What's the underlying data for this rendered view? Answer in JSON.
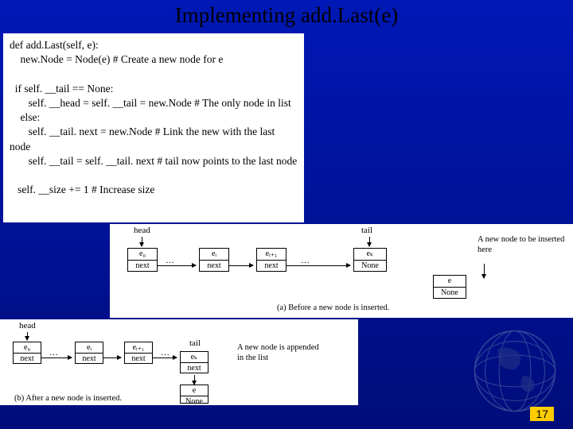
{
  "slide": {
    "title": "Implementing add.Last(e)",
    "page_number": "17"
  },
  "code": {
    "l1": "def add.Last(self, e):",
    "l2": "    new.Node = Node(e) # Create a new node for e",
    "l3": " ",
    "l4": "  if self. __tail == None:",
    "l5": "       self. __head = self. __tail = new.Node # The only node in list",
    "l6": "    else:",
    "l7": "       self. __tail. next = new.Node # Link the new with the last node",
    "l8": "       self. __tail = self. __tail. next # tail now points to the last node",
    "l9": " ",
    "l10": "   self. __size += 1 # Increase size"
  },
  "diagA": {
    "head": "head",
    "tail": "tail",
    "n0_top": "e₀",
    "n0_bot": "next",
    "ni_top": "eᵢ",
    "ni_bot": "next",
    "ni1_top": "eᵢ₊₁",
    "ni1_bot": "next",
    "nk_top": "eₖ",
    "nk_bot": "None",
    "new_top": "e",
    "new_bot": "None",
    "dots": "…",
    "side": "A new node to be inserted here",
    "caption": "(a) Before a new node is inserted."
  },
  "diagB": {
    "head": "head",
    "tail": "tail",
    "n0_top": "e₀",
    "n0_bot": "next",
    "ni_top": "eᵢ",
    "ni_bot": "next",
    "ni1_top": "eᵢ₊₁",
    "ni1_bot": "next",
    "nk_top": "eₖ",
    "nk_bot": "next",
    "new_top": "e",
    "new_bot": "None",
    "dots": "…",
    "side": "A new node is appended in the list",
    "caption": "(b) After a new node is inserted."
  }
}
